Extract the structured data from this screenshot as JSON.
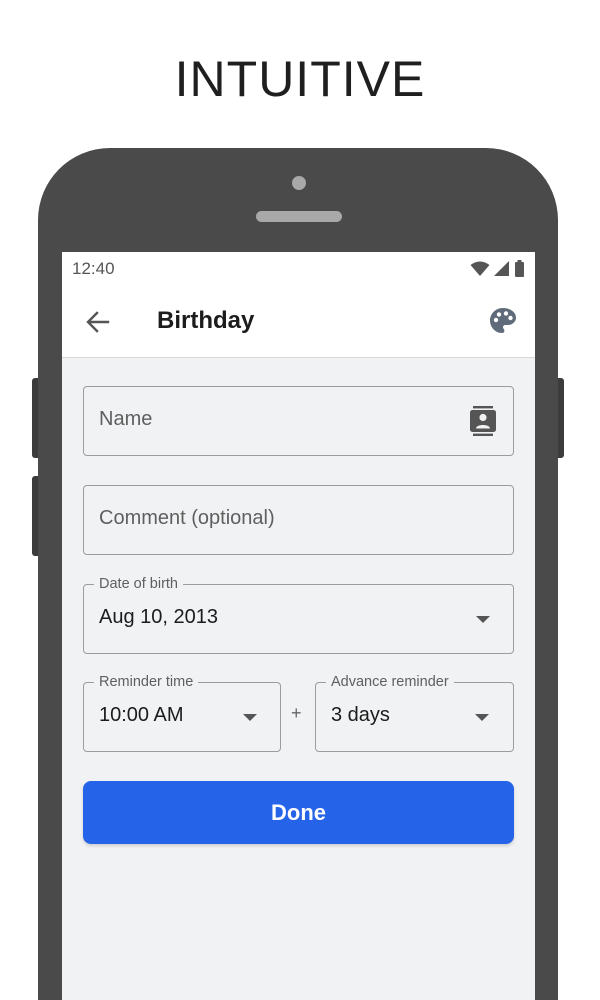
{
  "headline": "INTUITIVE",
  "status_bar": {
    "time": "12:40",
    "icons": [
      "wifi-icon",
      "signal-icon",
      "battery-icon"
    ]
  },
  "app_bar": {
    "title": "Birthday",
    "back_icon": "arrow-back-icon",
    "action_icon": "palette-icon"
  },
  "form": {
    "name": {
      "placeholder": "Name",
      "icon": "contacts-icon"
    },
    "comment": {
      "placeholder": "Comment (optional)"
    },
    "date_of_birth": {
      "label": "Date of birth",
      "value": "Aug 10, 2013"
    },
    "reminder_time": {
      "label": "Reminder time",
      "value": "10:00 AM"
    },
    "separator": "+",
    "advance_reminder": {
      "label": "Advance reminder",
      "value": "3 days"
    },
    "done_label": "Done"
  },
  "colors": {
    "primary": "#2563e8",
    "screen_background": "#f1f2f4",
    "phone_frame": "#4a4a4a"
  }
}
